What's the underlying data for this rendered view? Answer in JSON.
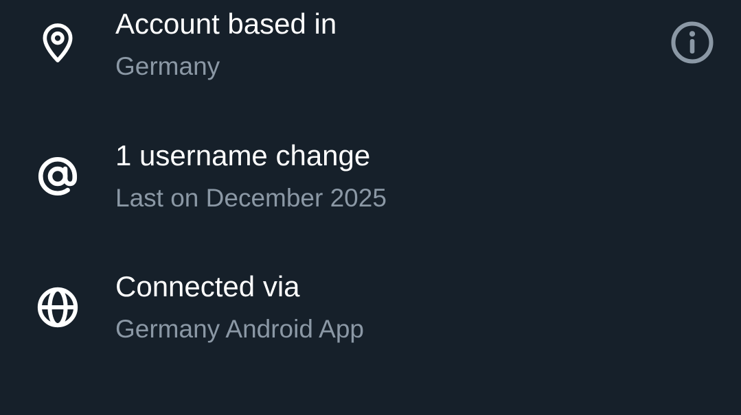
{
  "colors": {
    "background": "#16202a",
    "primary_text": "#ffffff",
    "secondary_text": "#8b98a5",
    "info_icon": "#8b98a5"
  },
  "rows": [
    {
      "icon": "location-pin-icon",
      "title": "Account based in",
      "subtitle": "Germany",
      "has_info_button": true
    },
    {
      "icon": "at-sign-icon",
      "title": "1 username change",
      "subtitle": "Last on December 2025"
    },
    {
      "icon": "globe-icon",
      "title": "Connected via",
      "subtitle": "Germany Android App"
    }
  ]
}
